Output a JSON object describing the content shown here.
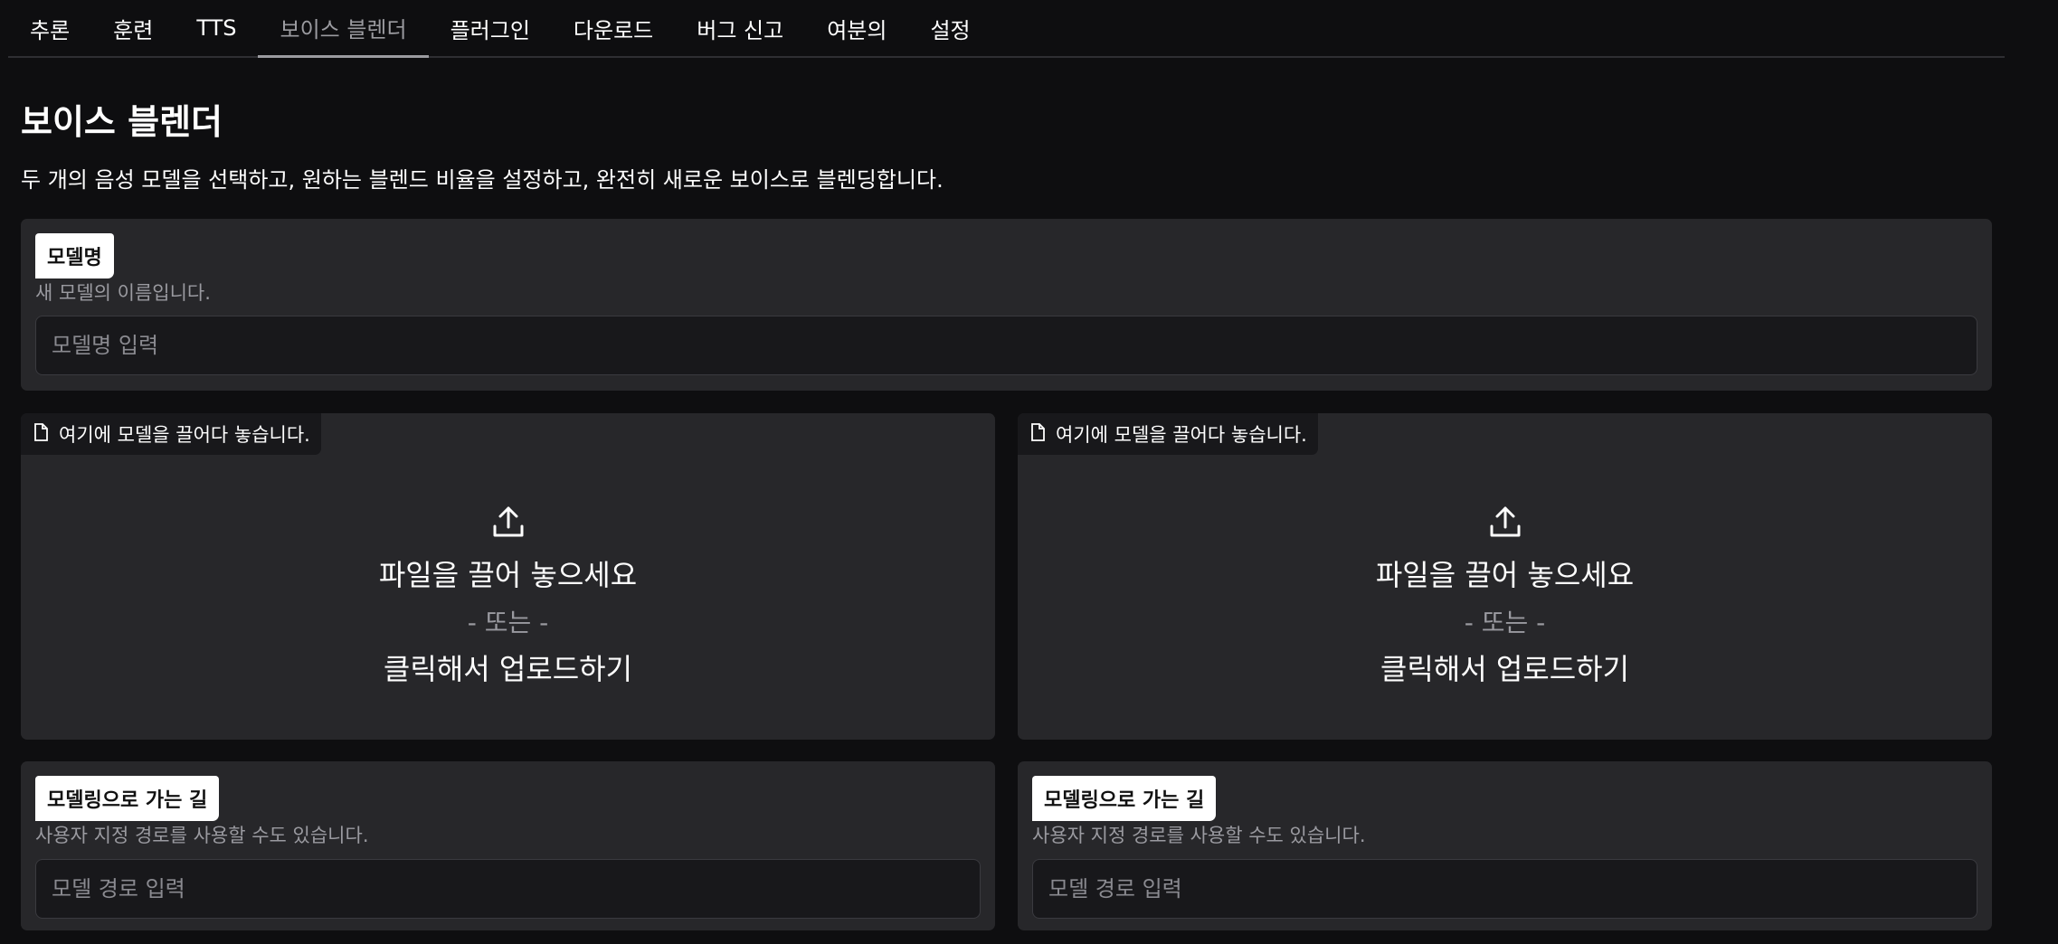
{
  "tabs": [
    {
      "label": "추론"
    },
    {
      "label": "훈련"
    },
    {
      "label": "TTS"
    },
    {
      "label": "보이스 블렌더",
      "active": true
    },
    {
      "label": "플러그인"
    },
    {
      "label": "다운로드"
    },
    {
      "label": "버그 신고"
    },
    {
      "label": "여분의"
    },
    {
      "label": "설정"
    }
  ],
  "page": {
    "title": "보이스 블렌더",
    "description": "두 개의 음성 모델을 선택하고, 원하는 블렌드 비율을 설정하고, 완전히 새로운 보이스로 블렌딩합니다."
  },
  "model_name": {
    "label": "모델명",
    "hint": "새 모델의 이름입니다.",
    "placeholder": "모델명 입력",
    "value": ""
  },
  "dropzones": [
    {
      "chip": "여기에 모델을 끌어다 놓습니다.",
      "main": "파일을 끌어 놓으세요",
      "or": "- 또는 -",
      "click": "클릭해서 업로드하기",
      "icon": "upload-icon"
    },
    {
      "chip": "여기에 모델을 끌어다 놓습니다.",
      "main": "파일을 끌어 놓으세요",
      "or": "- 또는 -",
      "click": "클릭해서 업로드하기",
      "icon": "upload-icon"
    }
  ],
  "model_paths": [
    {
      "label": "모델링으로 가는 길",
      "hint": "사용자 지정 경로를 사용할 수도 있습니다.",
      "placeholder": "모델 경로 입력",
      "value": ""
    },
    {
      "label": "모델링으로 가는 길",
      "hint": "사용자 지정 경로를 사용할 수도 있습니다.",
      "placeholder": "모델 경로 입력",
      "value": ""
    }
  ],
  "colors": {
    "background": "#0e0e10",
    "panel": "#27272a",
    "input": "#18181b",
    "active_tab": "#9b9ba0"
  }
}
